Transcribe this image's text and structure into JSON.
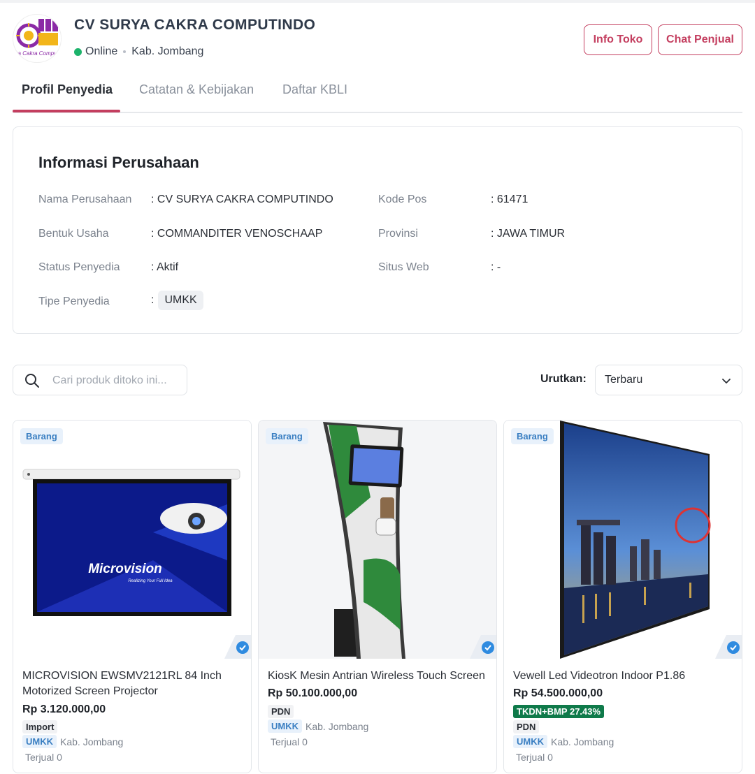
{
  "store": {
    "name": "CV SURYA CAKRA COMPUTINDO",
    "logo_caption": "Surya Cakra Computindo",
    "status": "Online",
    "location": "Kab. Jombang",
    "info_button": "Info Toko",
    "chat_button": "Chat Penjual"
  },
  "tabs": [
    {
      "label": "Profil Penyedia",
      "active": true
    },
    {
      "label": "Catatan & Kebijakan",
      "active": false
    },
    {
      "label": "Daftar KBLI",
      "active": false
    }
  ],
  "company_info": {
    "title": "Informasi Perusahaan",
    "fields": {
      "nama": {
        "label": "Nama Perusahaan",
        "value": ": CV SURYA CAKRA COMPUTINDO"
      },
      "bentuk": {
        "label": "Bentuk Usaha",
        "value": ": COMMANDITER VENOSCHAAP"
      },
      "status": {
        "label": "Status Penyedia",
        "value": ": Aktif"
      },
      "tipe": {
        "label": "Tipe Penyedia",
        "colon": ":",
        "value": "UMKK"
      },
      "kodepos": {
        "label": "Kode Pos",
        "value": ": 61471"
      },
      "provinsi": {
        "label": "Provinsi",
        "value": ": JAWA TIMUR"
      },
      "situs": {
        "label": "Situs Web",
        "value": ": -"
      }
    }
  },
  "search": {
    "placeholder": "Cari produk ditoko ini..."
  },
  "sort": {
    "label": "Urutkan:",
    "value": "Terbaru"
  },
  "products": [
    {
      "badge": "Barang",
      "image_brand_text": "Microvision",
      "image_tagline": "Realizing Your Full Idea",
      "title": "MICROVISION EWSMV2121RL 84 Inch Motorized Screen Projector",
      "price": "Rp 3.120.000,00",
      "tag": "Import",
      "vendor_type": "UMKK",
      "location": "Kab. Jombang",
      "sold": "Terjual 0"
    },
    {
      "badge": "Barang",
      "title": "KiosK Mesin Antrian Wireless Touch Screen",
      "price": "Rp 50.100.000,00",
      "tag": "PDN",
      "vendor_type": "UMKK",
      "location": "Kab. Jombang",
      "sold": "Terjual 0"
    },
    {
      "badge": "Barang",
      "title": "Vewell Led Videotron Indoor P1.86",
      "price": "Rp 54.500.000,00",
      "tkdn": "TKDN+BMP 27.43%",
      "tag": "PDN",
      "vendor_type": "UMKK",
      "location": "Kab. Jombang",
      "sold": "Terjual 0"
    }
  ],
  "colors": {
    "accent": "#c43e5f",
    "online": "#1db36b",
    "info_badge": "#3a7fc2",
    "tkdn": "#0f7a4a"
  }
}
